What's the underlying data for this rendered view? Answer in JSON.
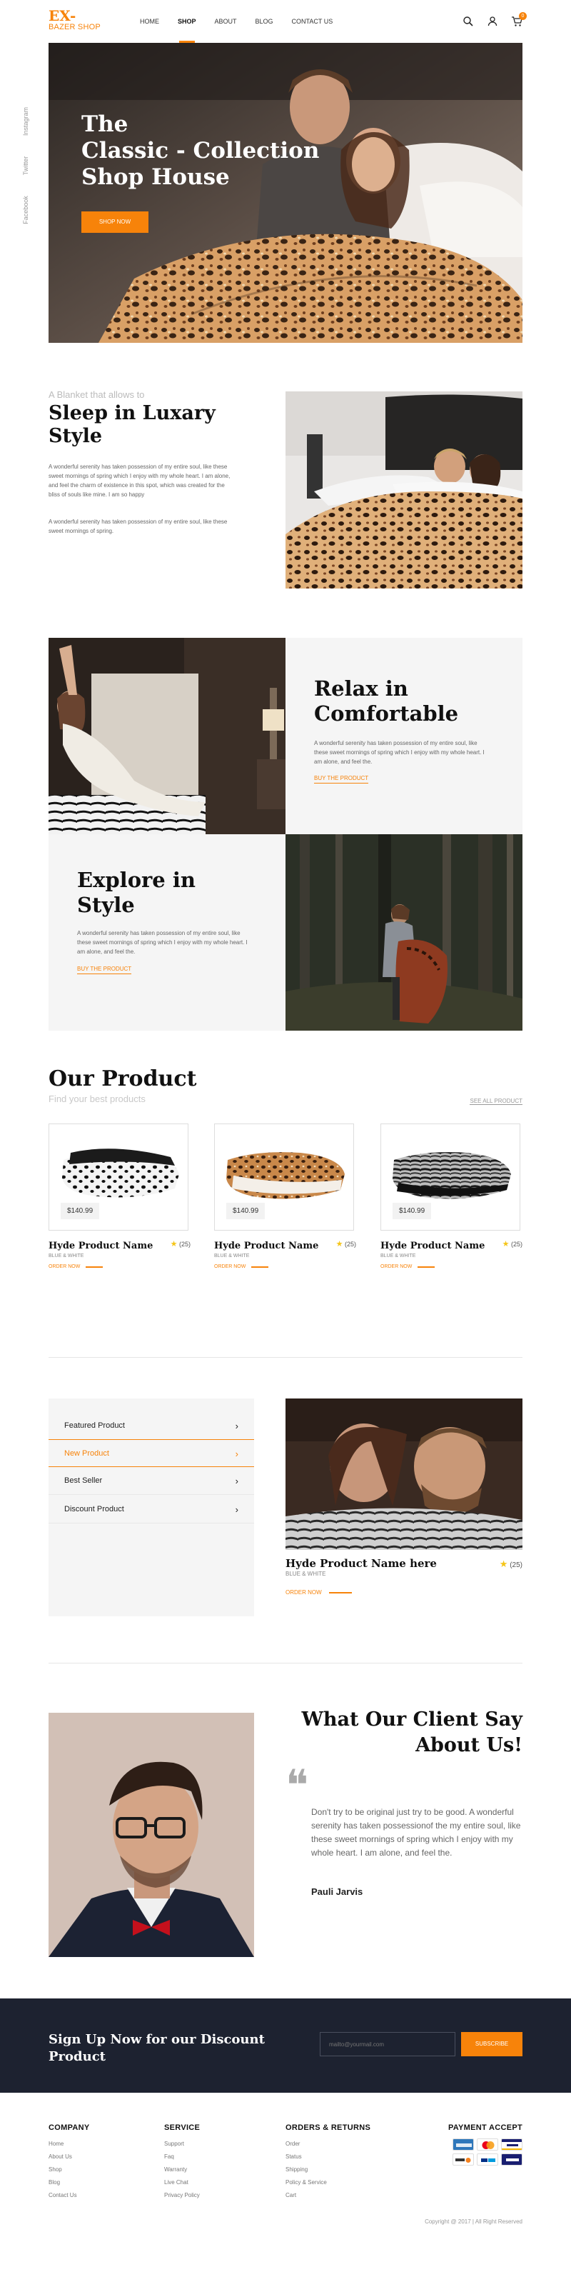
{
  "header": {
    "logo_line1": "EX-",
    "logo_line2": "BAZER SHOP",
    "nav": [
      "HOME",
      "SHOP",
      "ABOUT",
      "BLOG",
      "CONTACT US"
    ],
    "active_nav": "SHOP",
    "cart_count": "0"
  },
  "social": [
    "Instagram",
    "Twitter",
    "Facebook"
  ],
  "hero": {
    "title_line1": "The",
    "title_line2": "Classic - Collection",
    "title_line3": "Shop House",
    "button": "SHOP NOW"
  },
  "sleep": {
    "subtitle": "A Blanket that allows to",
    "title_line1": "Sleep in Luxary",
    "title_line2": "Style",
    "paragraph1": "A wonderful serenity has taken possession of my entire soul, like these sweet mornings of spring which I enjoy with my whole heart. I am alone, and feel the charm of existence in this spot, which was created for the bliss of souls like mine. I am so happy",
    "paragraph2": "A wonderful serenity has taken possession of my entire soul, like these sweet mornings of spring."
  },
  "relax": {
    "title_line1": "Relax in",
    "title_line2": "Comfortable",
    "text": "A wonderful serenity has taken possession of my entire soul, like these sweet mornings of spring which I enjoy with my whole heart. I am alone, and feel the.",
    "link": "BUY THE PRODUCT"
  },
  "explore": {
    "title_line1": "Explore in",
    "title_line2": "Style",
    "text": "A wonderful serenity has taken possession of my entire soul, like these sweet mornings of spring which I enjoy with my whole heart. I am alone, and feel the.",
    "link": "BUY THE PRODUCT"
  },
  "products": {
    "title": "Our Product",
    "subtitle": "Find your best products",
    "see_all": "SEE ALL PRODUCT",
    "items": [
      {
        "price": "$140.99",
        "name": "Hyde Product Name",
        "rating": "(25)",
        "sub": "BLUE & WHITE",
        "order": "ORDER NOW"
      },
      {
        "price": "$140.99",
        "name": "Hyde Product Name",
        "rating": "(25)",
        "sub": "BLUE & WHITE",
        "order": "ORDER NOW"
      },
      {
        "price": "$140.99",
        "name": "Hyde Product Name",
        "rating": "(25)",
        "sub": "BLUE & WHITE",
        "order": "ORDER NOW"
      }
    ]
  },
  "categories": {
    "items": [
      "Featured Product",
      "New Product",
      "Best Seller",
      "Discount Product"
    ],
    "active": "New Product",
    "featured": {
      "name": "Hyde Product Name here",
      "sub": "BLUE & WHITE",
      "rating": "(25)",
      "order": "ORDER NOW"
    }
  },
  "testimonial": {
    "title_line1": "What Our Client Say",
    "title_line2": "About Us!",
    "quote": "Don't try to be original just try to be good. A wonderful serenity has taken possessionof the my entire soul, like these sweet mornings of spring which I enjoy with my whole heart. I am alone, and feel the.",
    "author": "Pauli Jarvis"
  },
  "newsletter": {
    "title": "Sign Up Now for our Discount Product",
    "placeholder": "mailto@yourmail.com",
    "button": "SUBSCRIBE"
  },
  "footer": {
    "company": {
      "title": "COMPANY",
      "links": [
        "Home",
        "About Us",
        "Shop",
        "Blog",
        "Contact Us"
      ]
    },
    "service": {
      "title": "SERVICE",
      "links": [
        "Support",
        "Faq",
        "Warranty",
        "Live Chat",
        "Privacy Policy"
      ]
    },
    "orders": {
      "title": "ORDERS & RETURNS",
      "links": [
        "Order",
        "Status",
        "Shipping",
        "Policy & Service",
        "Cart"
      ]
    },
    "payment_title": "PAYMENT ACCEPT",
    "payment_cards": [
      "american-express",
      "mastercard",
      "visa",
      "discover",
      "paypal",
      "visa-electron"
    ],
    "copyright": "Copyright @ 2017 | All Right Reserved"
  },
  "colors": {
    "accent": "#f7830a",
    "dark": "#1d2230",
    "panel": "#f5f5f5"
  }
}
